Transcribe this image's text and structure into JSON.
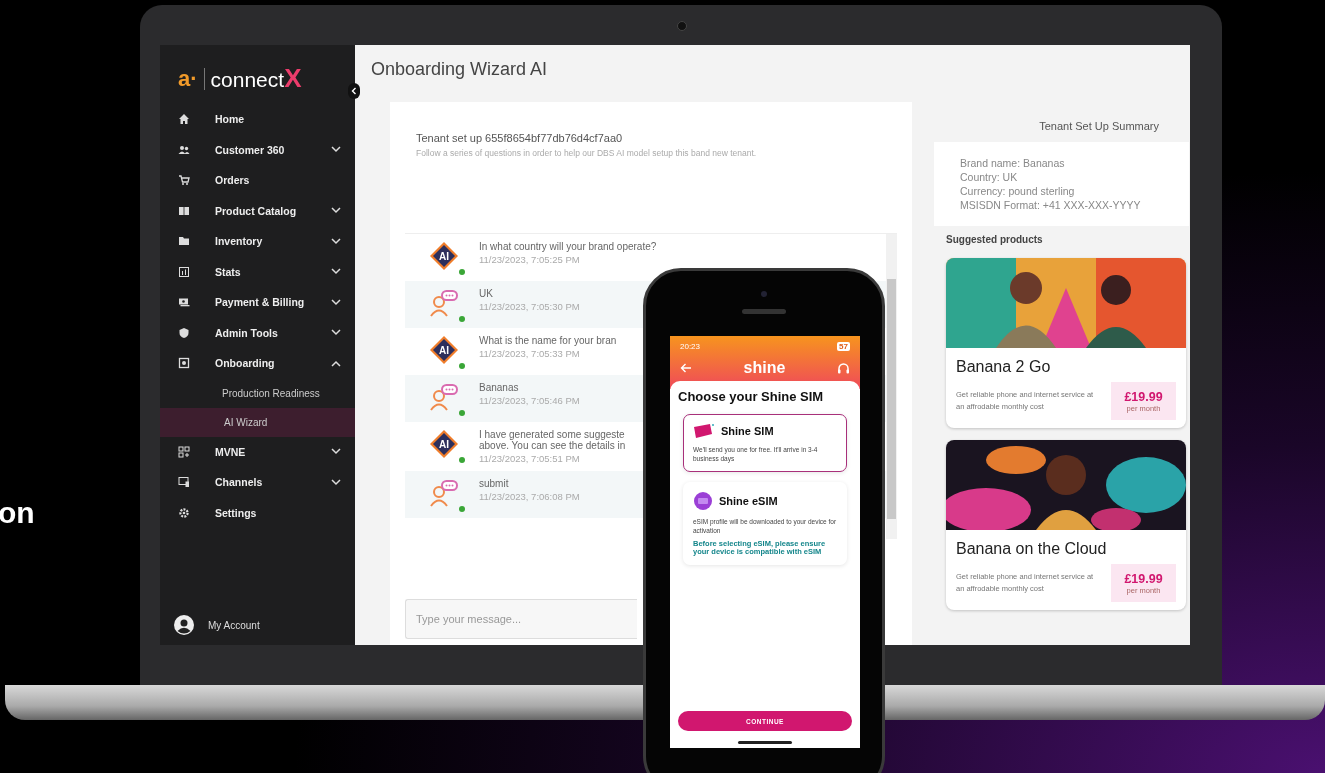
{
  "hero_text": "on",
  "sidebar": {
    "logo_mark": "a·",
    "logo_text": "connect",
    "logo_accent": "X",
    "items": [
      {
        "label": "Home",
        "selected": false
      },
      {
        "label": "Customer 360",
        "expanded": false,
        "selected": false
      },
      {
        "label": "Orders",
        "selected": false
      },
      {
        "label": "Product Catalog",
        "expanded": false,
        "selected": false
      },
      {
        "label": "Inventory",
        "expanded": false,
        "selected": false
      },
      {
        "label": "Stats",
        "expanded": false,
        "selected": false
      },
      {
        "label": "Payment & Billing",
        "expanded": false,
        "selected": false
      },
      {
        "label": "Admin Tools",
        "expanded": false,
        "selected": false
      },
      {
        "label": "Onboarding",
        "expanded": true,
        "selected": false,
        "children": [
          {
            "label": "Production Readiness",
            "selected": false
          },
          {
            "label": "AI Wizard",
            "selected": true
          }
        ]
      },
      {
        "label": "MVNE",
        "expanded": false,
        "selected": false
      },
      {
        "label": "Channels",
        "expanded": false,
        "selected": false
      },
      {
        "label": "Settings",
        "selected": false
      }
    ],
    "account": "My Account"
  },
  "main": {
    "title": "Onboarding Wizard AI",
    "card": {
      "heading": "Tenant set up 655f8654bf77db76d4cf7aa0",
      "subtitle": "Follow a series of questions in order to help our DBS AI model setup this band new tenant.",
      "messages": [
        {
          "kind": "bot",
          "avatar_label": "AI",
          "lines": [
            "In what country will your brand operate?"
          ],
          "time": "11/23/2023, 7:05:25 PM"
        },
        {
          "kind": "person",
          "lines": [
            "UK"
          ],
          "time": "11/23/2023, 7:05:30 PM"
        },
        {
          "kind": "bot",
          "avatar_label": "AI",
          "lines": [
            "What is the name for your bran"
          ],
          "time": "11/23/2023, 7:05:33 PM"
        },
        {
          "kind": "person",
          "lines": [
            "Bananas"
          ],
          "time": "11/23/2023, 7:05:46 PM"
        },
        {
          "kind": "bot",
          "avatar_label": "AI",
          "lines": [
            "I have generated some suggeste",
            "above. You can see the details in"
          ],
          "time": "11/23/2023, 7:05:51 PM"
        },
        {
          "kind": "person",
          "lines": [
            "submit"
          ],
          "time": "11/23/2023, 7:06:08 PM"
        }
      ],
      "input_placeholder": "Type your message..."
    }
  },
  "summary": {
    "title": "Tenant Set Up Summary",
    "lines": [
      "Brand name: Bananas",
      "Country: UK",
      "Currency: pound sterling",
      "MSISDN Format: +41 XXX-XXX-YYYY"
    ],
    "suggested_title": "Suggested products",
    "products": [
      {
        "name": "Banana 2 Go",
        "description": "Get reliable phone and internet service at an affrodable monthly cost",
        "price": "£19.99",
        "price_note": "per month"
      },
      {
        "name": "Banana on the Cloud",
        "description": "Get reliable phone and internet service at an affrodable monthly cost",
        "price": "£19.99",
        "price_note": "per month"
      }
    ]
  },
  "phone": {
    "time": "20:23",
    "battery": "57",
    "brand": "shine",
    "title": "Choose your Shine SIM",
    "options": [
      {
        "kind": "sim",
        "name": "Shine SIM",
        "description": "We'll send you one for free. It'll arrive in 3-4 business days",
        "selected": true
      },
      {
        "kind": "esim",
        "name": "Shine eSIM",
        "description": "eSIM profile will be downloaded to your device for activation",
        "note": "Before selecting eSIM, please ensure your device is compatible with eSIM",
        "selected": false
      }
    ],
    "button": "CONTINUE"
  }
}
